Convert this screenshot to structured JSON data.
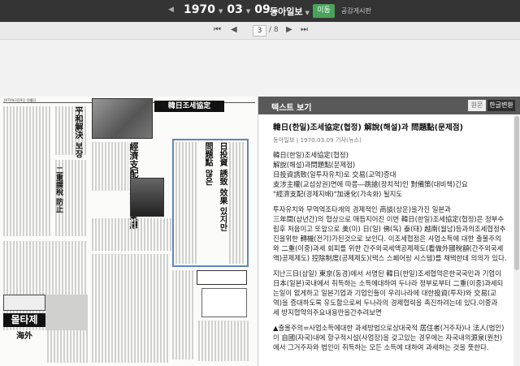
{
  "topbar": {
    "prev_label": "◀",
    "year": "1970",
    "month": "03",
    "day": "09",
    "caret": "▼",
    "paper_name": "동아일보",
    "go_label": "이동",
    "board_label": "공감게시판"
  },
  "pagebar": {
    "first": "⏮",
    "prev": "◀",
    "current_page": "3",
    "total": "/ 8",
    "next": "▶",
    "last": "⏭"
  },
  "newspaper": {
    "header_text": "1970年3月9日 月曜日",
    "banner": "韓日조세協定",
    "headline1": "二重課稅 防止",
    "headline2": "經濟支配 加速化 憂慮",
    "headline3": "日投資 誘致 效果 있지만",
    "headline4": "問題點 많은",
    "headline5": "平和解決 보장",
    "ad_brand": "몰타제",
    "ad_sub": "海外"
  },
  "panel": {
    "title": "텍스트 보기",
    "tab_original": "원문",
    "tab_korean": "한글변환",
    "article_title": "韓日(한일)조세協定(협정) 解說(해설)과 問題點(문제점)",
    "meta": "동아일보 | 1970.03.09 기사(뉴스)",
    "lines_a": [
      "韓日(한일)조세協定(협정)",
      "解說(해설)과問題點(문제점)",
      "日投資誘致(일투자유치)로 交易(교역)증대",
      "支涉主權(교섭상권)면에 따름―跳搶(장치적)인 對備策(대비책)긴요",
      "\"經濟支配(경제지배)\"加速化(가속화) 될지도"
    ],
    "lines_b": [
      "투자유치와 무역역조타개의 경제적인 商談(상운)을가진 일본과",
      "三年間(삼년간)의 협상으로 매듭지어진 이번 韓日(한일)조세協定(협정)은 정부수",
      "립후 처음이고 또앞으로 美(미) 日(일) 佛(독) 泰(태) 越南(월남)등과의조세협정추",
      "진을위한 轉機(전기)가된것으로 보인다. 이조세협정은 사업소득에 대한 출몰주의",
      "와 二重(이중)과세 회피를 위한 간주외국세액공제제도(看做外國稅額(간주외국세",
      "액)공제제도) 控除制度(공제제도)(택스 스페어링 시스템)를 채택한데 의의가 있다."
    ],
    "lines_c": [
      "지난三日(삼일) 東京(동경)에서 서명된 韓日(한일)조세협약은한국국민과 기업이",
      "日本(일본)국내에서 취득하는 소득에대하여 두나라 정부로부터 二重(이중)과세되",
      "는일이 없게하고 일본기업과 기업인들이 우리나라에 대한投資(투자)와 交易(교",
      "역)을 증대하도록 유도함으로써 두나라의 경제협력을 촉진하려는데 있다.이중과",
      "세 방지협약의주요내용만을간추려보면"
    ],
    "lines_d": [
      "▲출몰주의=사업소득에대한 과세방법으로상대국적 居住者(거주자)나 法人(법인)",
      "이 自國(자국)내에 항구적시설(사업장)을 갖고있는 경우에는 자국내의源泉(원천)",
      "에서 그거주자와 법인이 취득하는 모든 소득에 대하여 과세하는 것을 뜻한다."
    ]
  }
}
